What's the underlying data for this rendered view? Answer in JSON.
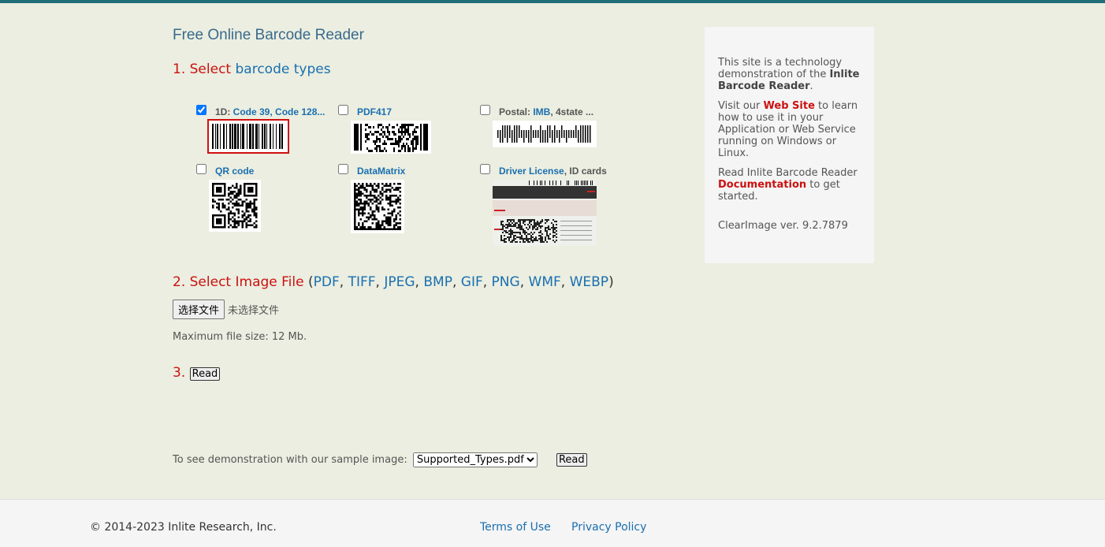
{
  "page": {
    "title": "Free Online Barcode Reader"
  },
  "step1": {
    "num": "1.",
    "select": "Select",
    "link": "barcode types"
  },
  "types": [
    {
      "prefix": "1D: ",
      "link": "Code 39, Code 128...",
      "suffix": "",
      "checked": true
    },
    {
      "prefix": "",
      "link": "PDF417",
      "suffix": "",
      "checked": false
    },
    {
      "prefix": "Postal: ",
      "link": "IMB",
      "suffix": ", 4state ...",
      "checked": false
    },
    {
      "prefix": "",
      "link": "QR code",
      "suffix": "",
      "checked": false
    },
    {
      "prefix": "",
      "link": "DataMatrix",
      "suffix": "",
      "checked": false
    },
    {
      "prefix": "",
      "link": "Driver License",
      "suffix": ", ID cards",
      "checked": false
    }
  ],
  "step2": {
    "num": "2.",
    "label": "Select Image File",
    "open_paren": "(",
    "close_paren": ")",
    "sep": ", ",
    "formats": [
      "PDF",
      "TIFF",
      "JPEG",
      "BMP",
      "GIF",
      "PNG",
      "WMF",
      "WEBP"
    ],
    "choose_label": "选择文件",
    "no_file": "未选择文件",
    "max_size": "Maximum file size: 12 Mb."
  },
  "step3": {
    "num": "3.",
    "read_label": "Read"
  },
  "sample": {
    "text": "To see demonstration with our sample image:",
    "selected": "Supported_Types.pdf",
    "read_label": "Read"
  },
  "sidebar": {
    "p1_text": "This site is a technology demonstration of the ",
    "p1_bold": "Inlite Barcode Reader",
    "p1_end": ".",
    "p2_start": "Visit our ",
    "p2_link": "Web Site",
    "p2_end": " to learn how to use it in your Application or Web Service running on Windows or Linux.",
    "p3_start": "Read Inlite Barcode Reader ",
    "p3_link": "Documentation",
    "p3_end": " to get started.",
    "version": "ClearImage ver. 9.2.7879"
  },
  "footer": {
    "copyright": "© 2014-2023 Inlite Research, Inc.",
    "terms": "Terms of Use",
    "privacy": "Privacy Policy"
  },
  "colors": {
    "background": "#ebeee0",
    "accent_red": "#cc1111",
    "link_blue": "#1a6fb0",
    "top_bar": "#1f6e7a"
  }
}
